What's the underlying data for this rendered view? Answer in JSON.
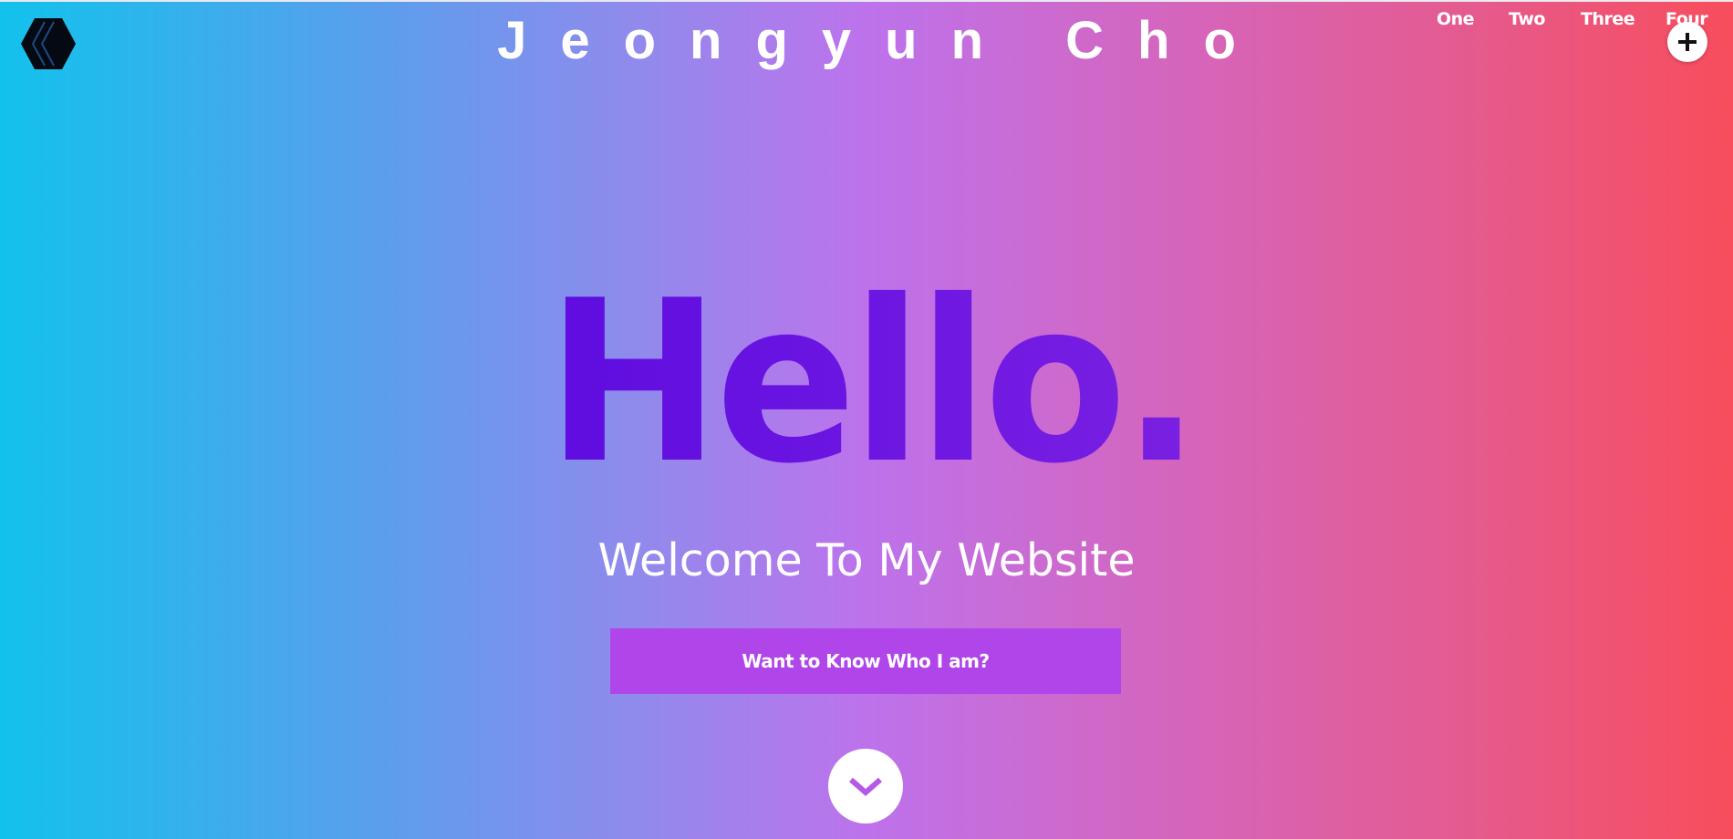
{
  "header": {
    "site_title": "Jeongyun Cho",
    "logo_icon": "hexagon-cube-logo-icon",
    "nav": [
      {
        "label": "One"
      },
      {
        "label": "Two"
      },
      {
        "label": "Three"
      },
      {
        "label": "Four"
      }
    ],
    "menu_button_icon": "plus-icon"
  },
  "hero": {
    "headline": "Hello.",
    "subtitle": "Welcome To My Website",
    "cta_label": "Want to Know Who I am?",
    "scroll_button_icon": "chevron-down-icon"
  },
  "colors": {
    "gradient_start": "#12c2ec",
    "gradient_mid": "#bd72ec",
    "gradient_end": "#f84d5c",
    "headline": "#6010e0",
    "cta_background": "#b046e9",
    "text": "#ffffff"
  }
}
